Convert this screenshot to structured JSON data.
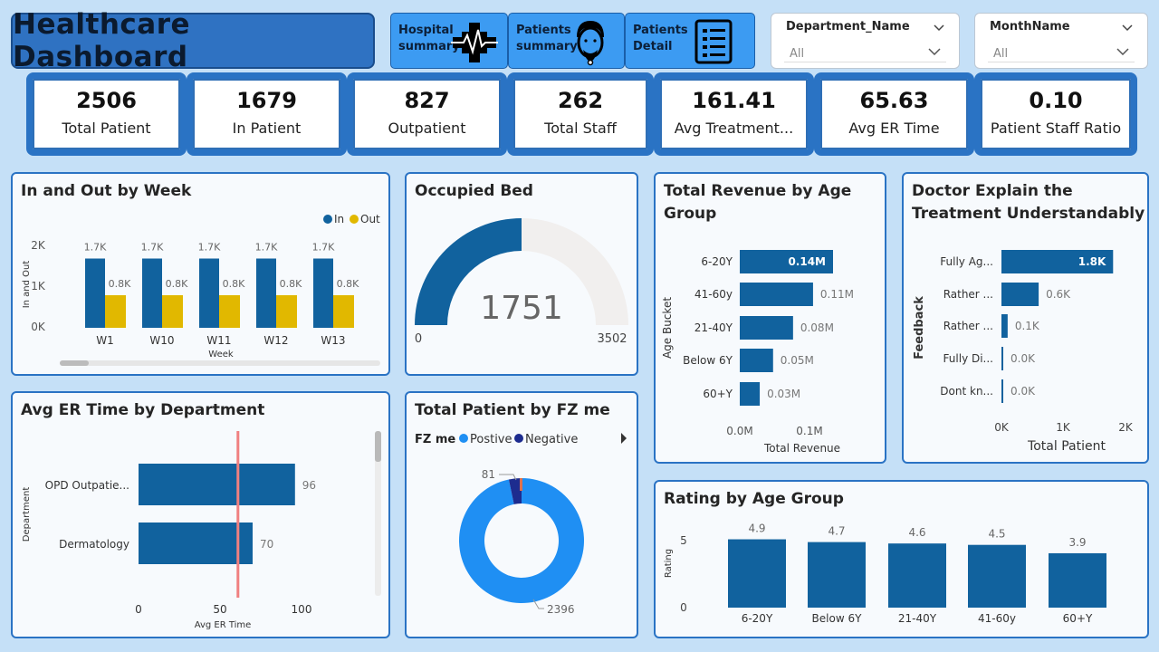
{
  "header": {
    "title": "Healthcare Dashboard",
    "nav": [
      {
        "label": "Hospital summary"
      },
      {
        "label": "Patients summary"
      },
      {
        "label": "Patients Detail"
      }
    ],
    "slicers": [
      {
        "title": "Department_Name",
        "value": "All"
      },
      {
        "title": "MonthName",
        "value": "All"
      }
    ]
  },
  "kpis": [
    {
      "value": "2506",
      "label": "Total Patient"
    },
    {
      "value": "1679",
      "label": "In Patient"
    },
    {
      "value": "827",
      "label": "Outpatient"
    },
    {
      "value": "262",
      "label": "Total Staff"
    },
    {
      "value": "161.41",
      "label": "Avg Treatment..."
    },
    {
      "value": "65.63",
      "label": "Avg ER Time"
    },
    {
      "value": "0.10",
      "label": "Patient Staff Ratio"
    }
  ],
  "colors": {
    "primary": "#11629e",
    "in": "#11629e",
    "out": "#e1b800",
    "positive": "#1f8ff3",
    "negative": "#1d2c8f",
    "ref_line": "#f08080",
    "gauge_track": "#f1efee"
  },
  "in_out": {
    "title": "In and Out by Week",
    "legend": [
      {
        "name": "In"
      },
      {
        "name": "Out"
      }
    ],
    "ylabel": "In and Out",
    "xlabel": "Week",
    "yticks": [
      "2K",
      "1K",
      "0K"
    ],
    "chart_data": {
      "type": "bar",
      "categories": [
        "W1",
        "W10",
        "W11",
        "W12",
        "W13"
      ],
      "series": [
        {
          "name": "In",
          "values": [
            1700,
            1700,
            1700,
            1700,
            1700
          ],
          "labels": [
            "1.7K",
            "1.7K",
            "1.7K",
            "1.7K",
            "1.7K"
          ]
        },
        {
          "name": "Out",
          "values": [
            800,
            800,
            800,
            800,
            800
          ],
          "labels": [
            "0.8K",
            "0.8K",
            "0.8K",
            "0.8K",
            "0.8K"
          ]
        }
      ],
      "ylim": [
        0,
        2000
      ]
    }
  },
  "occupied": {
    "title": "Occupied Bed",
    "value": "1751",
    "min": "0",
    "max": "3502",
    "fraction": 0.5
  },
  "revenue": {
    "title": "Total Revenue by Age Group",
    "ylabel": "Age Bucket",
    "xlabel": "Total Revenue",
    "xticks": [
      "0.0M",
      "0.1M"
    ],
    "chart_data": {
      "type": "bar",
      "orientation": "horizontal",
      "categories": [
        "6-20Y",
        "41-60y",
        "21-40Y",
        "Below 6Y",
        "60+Y"
      ],
      "values": [
        0.14,
        0.11,
        0.08,
        0.05,
        0.03
      ],
      "labels": [
        "0.14M",
        "0.11M",
        "0.08M",
        "0.05M",
        "0.03M"
      ],
      "xlim": [
        0,
        0.14
      ]
    }
  },
  "doctor": {
    "title": "Doctor Explain the Treatment Understandably",
    "ylabel": "Feedback",
    "xlabel": "Total Patient",
    "xticks": [
      "0K",
      "1K",
      "2K"
    ],
    "chart_data": {
      "type": "bar",
      "orientation": "horizontal",
      "categories": [
        "Fully Ag...",
        "Rather ...",
        "Rather ...",
        "Fully Di...",
        "Dont kn..."
      ],
      "values": [
        1800,
        600,
        100,
        0,
        0
      ],
      "labels": [
        "1.8K",
        "0.6K",
        "0.1K",
        "0.0K",
        "0.0K"
      ],
      "xlim": [
        0,
        2000
      ]
    }
  },
  "er_dept": {
    "title": "Avg ER Time by Department",
    "ylabel": "Department",
    "xlabel": "Avg ER Time",
    "xticks": [
      "0",
      "50",
      "100"
    ],
    "chart_data": {
      "type": "bar",
      "orientation": "horizontal",
      "categories": [
        "OPD Outpatie...",
        "Dermatology"
      ],
      "values": [
        96,
        70
      ],
      "labels": [
        "96",
        "70"
      ],
      "reference_line": 61,
      "xlim": [
        0,
        100
      ]
    }
  },
  "fz": {
    "title": "Total Patient by FZ me",
    "legend_title": "FZ me",
    "legend": [
      {
        "name": "Postive"
      },
      {
        "name": "Negative"
      }
    ],
    "chart_data": {
      "type": "pie",
      "labels": [
        "Postive",
        "Negative"
      ],
      "values": [
        2396,
        81
      ],
      "data_labels": [
        "2396",
        "81"
      ],
      "donut": true
    }
  },
  "rating": {
    "title": "Rating by Age Group",
    "ylabel": "Rating",
    "yticks": [
      "5",
      "0"
    ],
    "chart_data": {
      "type": "bar",
      "categories": [
        "6-20Y",
        "Below 6Y",
        "21-40Y",
        "41-60y",
        "60+Y"
      ],
      "values": [
        4.9,
        4.7,
        4.6,
        4.5,
        3.9
      ],
      "labels": [
        "4.9",
        "4.7",
        "4.6",
        "4.5",
        "3.9"
      ],
      "ylim": [
        0,
        5
      ]
    }
  }
}
